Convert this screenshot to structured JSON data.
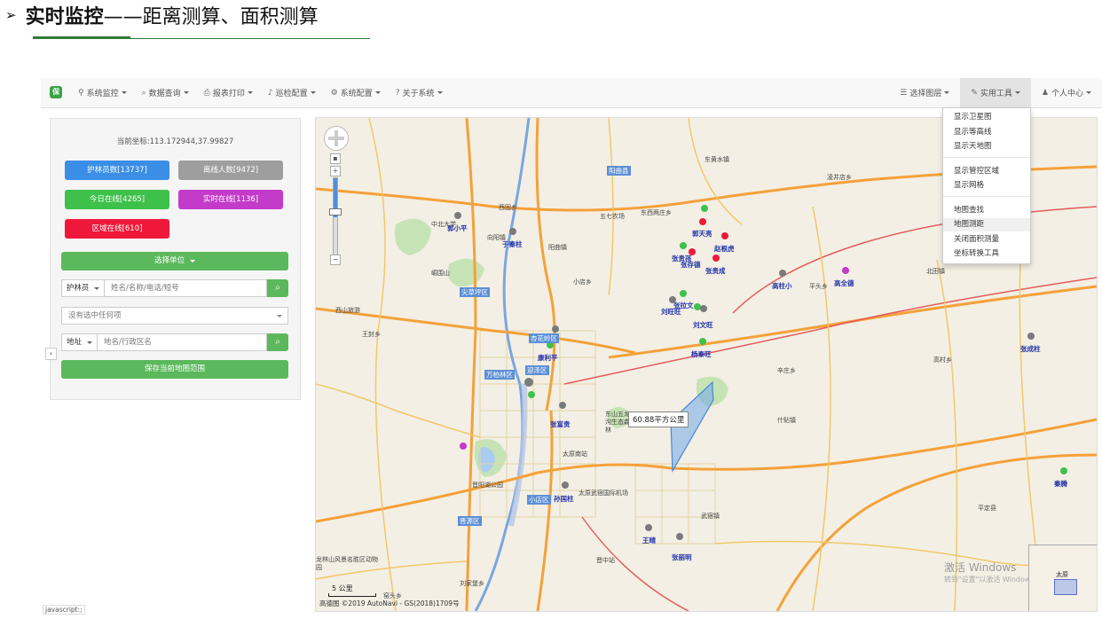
{
  "slide": {
    "title_bold": "实时监控",
    "title_rest": "——距离测算、面积测算",
    "bullet": "➢"
  },
  "navbar": {
    "brand": "保",
    "left_items": [
      {
        "icon": "map-marker-icon",
        "glyph": "⚲",
        "label": "系统监控"
      },
      {
        "icon": "search-icon",
        "glyph": "⌕",
        "label": "数据查询"
      },
      {
        "icon": "print-icon",
        "glyph": "⎙",
        "label": "报表打印"
      },
      {
        "icon": "bell-icon",
        "glyph": "♪",
        "label": "巡检配置"
      },
      {
        "icon": "gear-icon",
        "glyph": "⚙",
        "label": "系统配置"
      },
      {
        "icon": "question-icon",
        "glyph": "?",
        "label": "关于系统"
      }
    ],
    "right_items": [
      {
        "icon": "list-icon",
        "glyph": "☰",
        "label": "选择图层"
      },
      {
        "icon": "wrench-icon",
        "glyph": "✎",
        "label": "实用工具"
      },
      {
        "icon": "user-icon",
        "glyph": "♟",
        "label": "个人中心"
      }
    ]
  },
  "dropdown": {
    "items": [
      "显示卫星图",
      "显示等高线",
      "显示天地图",
      "显示管控区域",
      "显示网格",
      "地图查找",
      "地图测距",
      "关闭面积测量",
      "坐标转换工具"
    ],
    "highlighted": "地图测距"
  },
  "panel": {
    "coord": "当前坐标:113.172944,37.99827",
    "buttons": [
      {
        "label": "护林员数[13737]",
        "color": "#3a8ee6"
      },
      {
        "label": "离线人数[9472]",
        "color": "#9e9e9e"
      },
      {
        "label": "今日在线[4265]",
        "color": "#3ec14a"
      },
      {
        "label": "实时在线[1136]",
        "color": "#c33bc9"
      },
      {
        "label": "区域在线[610]",
        "color": "#f0183a"
      }
    ],
    "select_unit": "选择单位",
    "search1_label": "护林员",
    "search1_placeholder": "姓名/名称/电话/短号",
    "task_select": "没有选中任何项",
    "search2_label": "地址",
    "search2_placeholder": "地名/行政区名",
    "save_button": "保存当前地图范围",
    "collapse": "‹"
  },
  "status_text": "javascript:;",
  "map": {
    "measure_label": "60.88平方公里",
    "scale": "5 公里",
    "copyright": "高德图   ©2019 AutoNavi - GS(2018)1709号",
    "watermark_line1": "激活 Windows",
    "watermark_line2": "转到\"设置\"以激活 Windows。",
    "overview_label": "太原",
    "districts": [
      "尖草坪区",
      "杏花岭区",
      "万柏林区",
      "迎泽区",
      "小店区",
      "晋源区",
      "阳曲县"
    ],
    "places": [
      "郭小平",
      "于秦柱",
      "郭天亮",
      "赵根虎",
      "张贵孩",
      "张存德",
      "张贵成",
      "高柱小",
      "高全德",
      "刘旺旺",
      "张拉文",
      "刘文旺",
      "杨秦旺",
      "康利平",
      "张富贵",
      "孙国柱",
      "王晴",
      "张丽明",
      "张成柱",
      "秦腾"
    ],
    "labels": [
      "中北大学",
      "西固乡",
      "向阳镇",
      "阳曲镇",
      "东黄水镇",
      "凌井店乡",
      "五七农场",
      "东西两庄乡",
      "小店乡",
      "崛围山",
      "西山旅游",
      "王封乡",
      "平头乡",
      "高村乡",
      "辛庄乡",
      "武宿镇",
      "刘家堡乡",
      "龙林山风景名胜区动物园",
      "太原南站",
      "太原武宿国际机场",
      "晋中站",
      "东山五龙沟生态森林",
      "晋阳湖公园",
      "平定县",
      "窑头乡",
      "什贴镇",
      "北田镇"
    ]
  }
}
